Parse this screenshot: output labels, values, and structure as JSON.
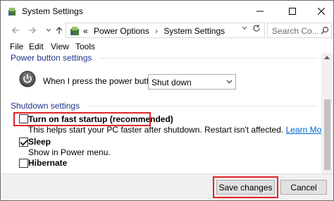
{
  "window": {
    "title": "System Settings",
    "controls": {
      "minimize": "—",
      "maximize": "☐",
      "close": "✕"
    }
  },
  "navigation": {
    "back_icon": "arrow-left-icon",
    "forward_icon": "arrow-right-icon",
    "up_icon": "arrow-up-icon",
    "breadcrumb_prefix": "«",
    "breadcrumb": [
      "Power Options",
      "System Settings"
    ],
    "breadcrumb_separator": "›",
    "search_placeholder": "Search Co..."
  },
  "menu": {
    "items": [
      "File",
      "Edit",
      "View",
      "Tools"
    ]
  },
  "power_button_settings": {
    "title": "Power button settings",
    "label": "When I press the power button:",
    "selected": "Shut down"
  },
  "shutdown_settings": {
    "title": "Shutdown settings",
    "options": [
      {
        "label": "Turn on fast startup (recommended)",
        "checked": false,
        "description": "This helps start your PC faster after shutdown. Restart isn't affected.",
        "link": "Learn More"
      },
      {
        "label": "Sleep",
        "checked": true,
        "description": "Show in Power menu."
      },
      {
        "label": "Hibernate",
        "checked": false
      }
    ]
  },
  "footer": {
    "save_label": "Save changes",
    "cancel_label": "Cancel"
  },
  "colors": {
    "highlight": "#e0242a",
    "section_title": "#1e3287",
    "link": "#0066cc"
  }
}
